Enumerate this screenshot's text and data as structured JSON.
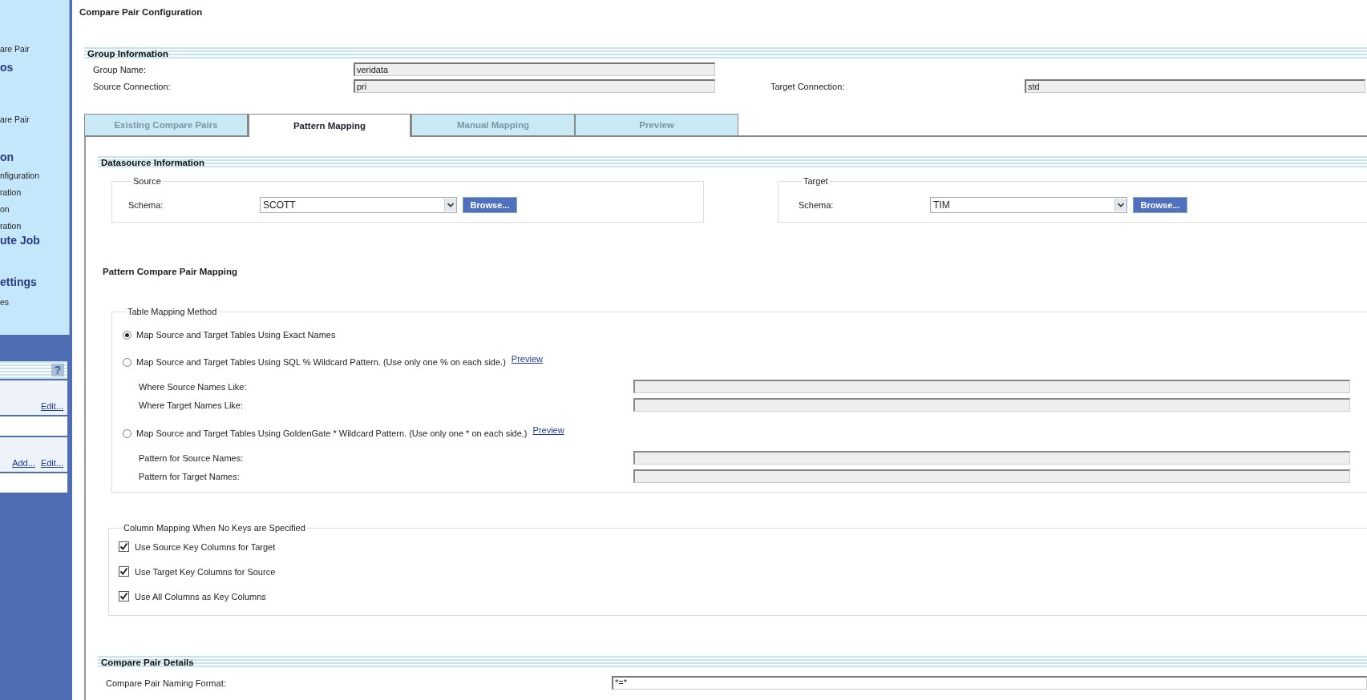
{
  "sidebar": {
    "nav_items": [
      {
        "text": "are Pair",
        "kind": "item"
      },
      {
        "text": "os",
        "kind": "heading"
      },
      {
        "text": "are Pair",
        "kind": "item"
      },
      {
        "text": "on",
        "kind": "heading"
      },
      {
        "text": "nfiguration",
        "kind": "item"
      },
      {
        "text": "ration",
        "kind": "item"
      },
      {
        "text": "on",
        "kind": "item"
      },
      {
        "text": "ration",
        "kind": "item"
      },
      {
        "text": "ute Job",
        "kind": "heading"
      },
      {
        "text": "ettings",
        "kind": "heading"
      },
      {
        "text": "es",
        "kind": "item"
      }
    ],
    "help": "?",
    "panels": [
      {
        "links": [
          "Edit..."
        ]
      },
      {
        "links": [
          "Add...",
          "Edit..."
        ]
      }
    ]
  },
  "page_title": "Compare Pair Configuration",
  "group_information": {
    "title": "Group Information",
    "fields": [
      {
        "label": "Group Name:",
        "value": "veridata"
      },
      {
        "label": "Source Connection:",
        "value": "pri"
      },
      {
        "label": "Target Connection:",
        "value": "std"
      }
    ]
  },
  "tabs": [
    {
      "label": "Existing Compare Pairs",
      "selected": false
    },
    {
      "label": "Pattern Mapping",
      "selected": true
    },
    {
      "label": "Manual Mapping",
      "selected": false
    },
    {
      "label": "Preview",
      "selected": false
    }
  ],
  "datasource": {
    "title": "Datasource Information",
    "panes": [
      {
        "legend": "Source",
        "label": "Schema:",
        "value": "SCOTT",
        "button": "Browse..."
      },
      {
        "legend": "Target",
        "label": "Schema:",
        "value": "TIM",
        "button": "Browse..."
      }
    ]
  },
  "pattern_mapping": {
    "title": "Pattern Compare Pair Mapping",
    "table_mapping": {
      "legend": "Table Mapping Method",
      "options": [
        {
          "label": "Map Source and Target Tables Using Exact Names",
          "selected": true
        },
        {
          "label": "Map Source and Target Tables Using SQL % Wildcard Pattern. (Use only one % on each side.)",
          "selected": false,
          "link": "Preview",
          "fields": [
            {
              "label": "Where Source Names Like:",
              "disabled": true
            },
            {
              "label": "Where Target Names Like:",
              "disabled": true
            }
          ]
        },
        {
          "label": "Map Source and Target Tables Using GoldenGate * Wildcard Pattern. (Use only one * on each side.)",
          "selected": false,
          "link": "Preview",
          "fields": [
            {
              "label": "Pattern for Source Names:",
              "disabled": true
            },
            {
              "label": "Pattern for Target Names:",
              "disabled": true
            }
          ]
        }
      ]
    },
    "column_mapping": {
      "legend": "Column Mapping When No Keys are Specified",
      "options": [
        {
          "label": "Use Source Key Columns for Target",
          "checked": true
        },
        {
          "label": "Use Target Key Columns for Source",
          "checked": true
        },
        {
          "label": "Use All Columns as Key Columns",
          "checked": true
        }
      ]
    }
  },
  "compare_pair_details": {
    "title": "Compare Pair Details",
    "fields": [
      {
        "label": "Compare Pair Naming Format:",
        "value": "*=*"
      }
    ]
  }
}
